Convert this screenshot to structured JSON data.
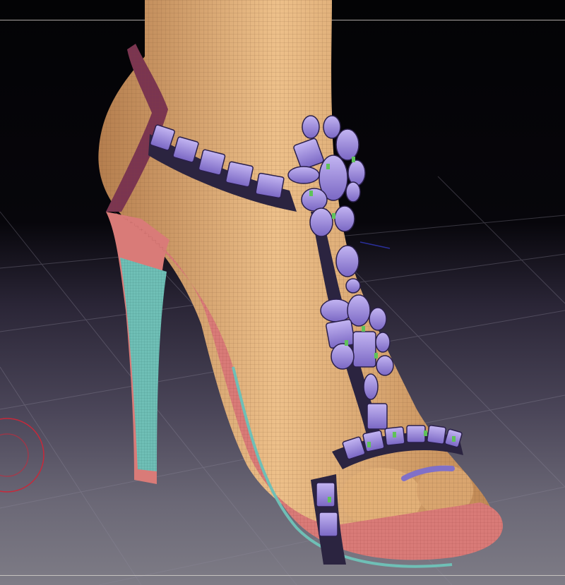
{
  "viewport": {
    "background_top": "#030305",
    "background_bottom": "#7e7c86"
  },
  "model": {
    "skin_color": "#e2b078",
    "wireframe_color": "#7a5433",
    "strap_color": "#2b2440",
    "gem_color": "#9a88d6",
    "gem_accent": "#5fc25a",
    "sole_color": "#d97b78",
    "heel_color": "#6fbfb6",
    "back_strap_color": "#7a3550"
  },
  "gizmo": {
    "ring_color": "#c8283a"
  }
}
